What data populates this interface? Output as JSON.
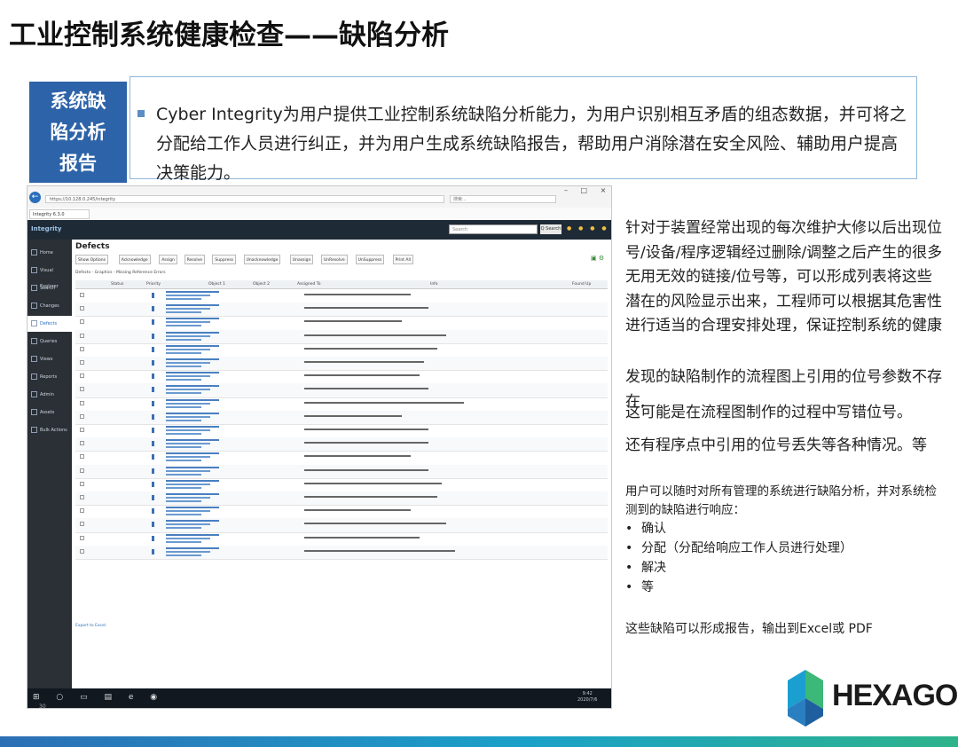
{
  "slide": {
    "title": "工业控制系统健康检查——缺陷分析",
    "section_label": "系统缺陷分析报告",
    "section_text": "Cyber Integrity为用户提供工业控制系统缺陷分析能力，为用户识别相互矛盾的组态数据，并可将之分配给工作人员进行纠正，并为用户生成系统缺陷报告，帮助用户消除潜在安全风险、辅助用户提高决策能力。",
    "page_number": "30",
    "paragraph_1": "针对于装置经常出现的每次维护大修以后出现位号/设备/程序逻辑经过删除/调整之后产生的很多无用无效的链接/位号等，可以形成列表将这些潜在的风险显示出来，工程师可以根据其危害性进行适当的合理安排处理，保证控制系统的健康",
    "paragraph_2": "发现的缺陷制作的流程图上引用的位号参数不存在,",
    "paragraph_3": "这可能是在流程图制作的过程中写错位号。",
    "paragraph_4": "还有程序点中引用的位号丢失等各种情况。等",
    "paragraph_5": "用户可以随时对所有管理的系统进行缺陷分析，并对系统检测到的缺陷进行响应：",
    "response_items": [
      "确认",
      "分配（分配给响应工作人员进行处理）",
      "解决",
      "等"
    ],
    "paragraph_6": "这些缺陷可以形成报告，输出到Excel或 PDF",
    "logo_text": "HEXAGON",
    "colors": {
      "label_bg": "#2d63a8",
      "border": "#8fb7d8",
      "stripe_start": "#2c6fb5",
      "stripe_end": "#2db38a"
    }
  },
  "screenshot": {
    "url": "https://10.128.0.245/integrity",
    "search_hint": "搜索...",
    "tab_label": "Integrity 6.3.0",
    "app_name": "Integrity",
    "app_search_placeholder": "Search",
    "app_search_button": "Q Search",
    "page_heading": "Defects",
    "toolbar_buttons": [
      "Show Options",
      "Acknowledge",
      "Assign",
      "Resolve",
      "Suppress",
      "Unacknowledge",
      "Unassign",
      "UnResolve",
      "UnSuppress",
      "Print All"
    ],
    "breadcrumb": "Defects - Graphics - Missing Reference Errors",
    "columns": [
      "Status",
      "Priority",
      "Object 1",
      "Object 2",
      "Assigned To",
      "Info",
      "Found Up"
    ],
    "sidebar_items": [
      "Home",
      "Visual Explorer",
      "Search",
      "Changes",
      "Defects",
      "Queries",
      "Views",
      "Reports",
      "Admin",
      "Assets",
      "Bulk Actions"
    ],
    "active_sidebar": "Defects",
    "row_count": 20,
    "footer_link": "Export to Excel",
    "taskbar_time": "9:42",
    "taskbar_date": "2020/7/6"
  }
}
